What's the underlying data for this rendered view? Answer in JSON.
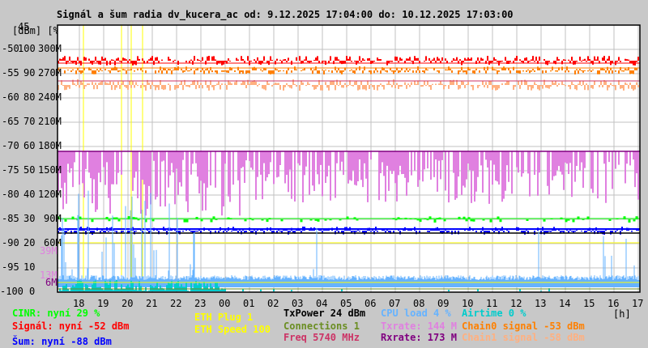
{
  "chart_data": {
    "type": "line",
    "title": "Signál a šum radia dv_kucera_ac od: 9.12.2025 17:04:00 do: 10.12.2025 17:03:00",
    "ylabel": "[dBm] [%]",
    "xlabel": "[h]",
    "y_top_label": "45",
    "x_ticks": [
      "18",
      "19",
      "20",
      "21",
      "22",
      "23",
      "00",
      "01",
      "02",
      "03",
      "04",
      "05",
      "06",
      "07",
      "08",
      "09",
      "10",
      "11",
      "12",
      "13",
      "14",
      "15",
      "16",
      "17"
    ],
    "y_ticks_dbm": [
      "-50",
      "-55",
      "-60",
      "-65",
      "-70",
      "-75",
      "-80",
      "-85",
      "-90",
      "-95",
      "-100"
    ],
    "y_ticks_pct": [
      "100",
      "90",
      "80",
      "70",
      "60",
      "50",
      "40",
      "30",
      "20",
      "10",
      "0"
    ],
    "y_ticks_rate": [
      "300M",
      "270M",
      "240M",
      "210M",
      "180M",
      "150M",
      "120M",
      "90M",
      "60M",
      "",
      ""
    ],
    "extra_rate_ticks": [
      {
        "label": "39M",
        "color": "#e080e0"
      },
      {
        "label": "13M",
        "color": "#e080e0"
      },
      {
        "label": "6M",
        "color": "#800080"
      }
    ],
    "ylim_dbm": [
      -100,
      -45
    ],
    "series": [
      {
        "name": "CINR",
        "legend": "CINR: nyní 29 %",
        "color": "#00ff00",
        "current": 29
      },
      {
        "name": "Signál",
        "legend": "Signál: nyní -52 dBm",
        "color": "#ff0000",
        "current": -52
      },
      {
        "name": "Šum",
        "legend": "Šum: nyní -88 dBm",
        "color": "#0000ff",
        "current": -88
      },
      {
        "name": "ETH Plug",
        "legend": "ETH Plug 1",
        "color": "#ffff00",
        "current": 1
      },
      {
        "name": "ETH Speed",
        "legend": "ETH Speed 100",
        "color": "#ffff00",
        "current": 100
      },
      {
        "name": "TxPower",
        "legend": "TxPower 24 dBm",
        "color": "#000000",
        "current": 24
      },
      {
        "name": "Connections",
        "legend": "Connections 1",
        "color": "#6b8e23",
        "current": 1
      },
      {
        "name": "Freq",
        "legend": "Freq 5740 MHz",
        "color": "#cc3366",
        "current": 5740
      },
      {
        "name": "CPU load",
        "legend": "CPU load 4 %",
        "color": "#66b3ff",
        "current": 4
      },
      {
        "name": "Txrate",
        "legend": "Txrate: 144 M",
        "color": "#e080e0",
        "current": 144
      },
      {
        "name": "Rxrate",
        "legend": "Rxrate: 173 M",
        "color": "#800080",
        "current": 173
      },
      {
        "name": "Airtime",
        "legend": "Airtime 0 %",
        "color": "#00cccc",
        "current": 0
      },
      {
        "name": "Chain0 signal",
        "legend": "Chain0 signal -53 dBm",
        "color": "#ff8000",
        "current": -53
      },
      {
        "name": "Chain1 signal",
        "legend": "Chain1 signal -58 dBm",
        "color": "#ffb080",
        "current": -58
      }
    ]
  }
}
